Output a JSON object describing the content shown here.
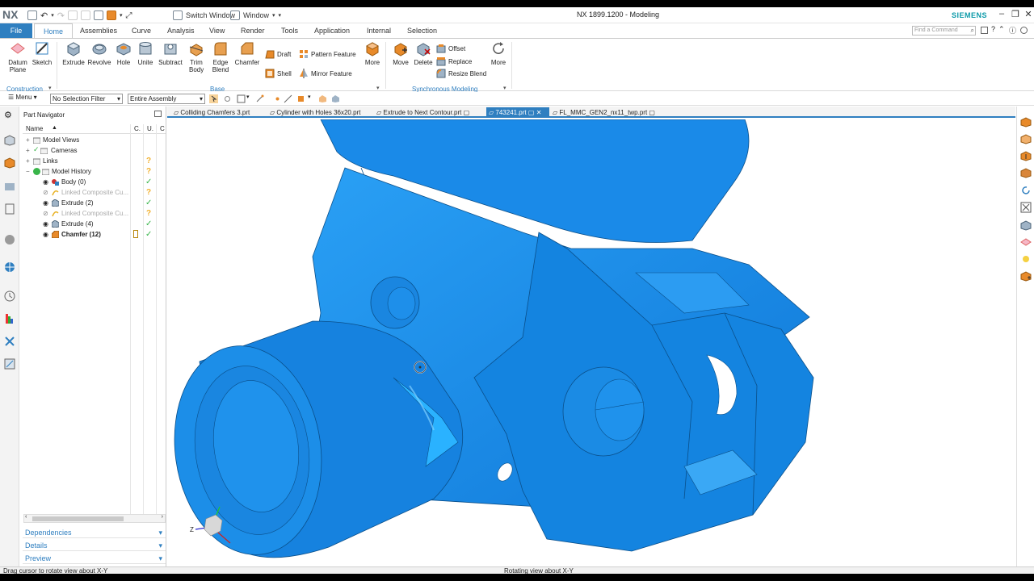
{
  "app": {
    "logo": "NX",
    "title": "NX 1899.1200 - Modeling",
    "brand": "SIEMENS",
    "quick_access": {
      "switch_window": "Switch Window",
      "window": "Window"
    },
    "window_controls": [
      "minimize-icon",
      "restore-icon",
      "close-icon"
    ]
  },
  "menu_tabs": {
    "file": "File",
    "items": [
      "Home",
      "Assemblies",
      "Curve",
      "Analysis",
      "View",
      "Render",
      "Tools",
      "Application",
      "Internal",
      "Selection"
    ],
    "active": "Home",
    "find_command_placeholder": "Find a Command"
  },
  "ribbon": {
    "construction": {
      "label": "Construction",
      "datum_plane": "Datum Plane",
      "sketch": "Sketch"
    },
    "base": {
      "label": "Base",
      "extrude": "Extrude",
      "revolve": "Revolve",
      "hole": "Hole",
      "unite": "Unite",
      "subtract": "Subtract",
      "trim_body": "Trim Body",
      "edge_blend": "Edge Blend",
      "chamfer": "Chamfer",
      "draft": "Draft",
      "shell": "Shell",
      "pattern_feature": "Pattern Feature",
      "mirror_feature": "Mirror Feature",
      "more": "More"
    },
    "synchronous": {
      "label": "Synchronous Modeling",
      "move": "Move",
      "delete": "Delete",
      "offset": "Offset",
      "replace": "Replace",
      "resize_blend": "Resize Blend",
      "more": "More"
    }
  },
  "selection_bar": {
    "menu": "Menu",
    "filter": "No Selection Filter",
    "scope": "Entire Assembly"
  },
  "part_navigator": {
    "title": "Part Navigator",
    "columns": {
      "name": "Name",
      "c": "C.",
      "u": "U.",
      "c2": "C"
    },
    "rows": [
      {
        "label": "Model Views",
        "indent": 0,
        "status": ""
      },
      {
        "label": "Cameras",
        "indent": 0,
        "status": ""
      },
      {
        "label": "Links",
        "indent": 0,
        "status": "?"
      },
      {
        "label": "Model History",
        "indent": 0,
        "status": "?"
      },
      {
        "label": "Body (0)",
        "indent": 1,
        "status": "ok"
      },
      {
        "label": "Linked Composite Cu...",
        "indent": 1,
        "status": "?",
        "grey": true
      },
      {
        "label": "Extrude (2)",
        "indent": 1,
        "status": "ok"
      },
      {
        "label": "Linked Composite Cu...",
        "indent": 1,
        "status": "?",
        "grey": true
      },
      {
        "label": "Extrude (4)",
        "indent": 1,
        "status": "ok"
      },
      {
        "label": "Chamfer (12)",
        "indent": 1,
        "status": "ok",
        "bold": true
      }
    ],
    "panels": [
      "Dependencies",
      "Details",
      "Preview"
    ]
  },
  "doc_tabs": [
    {
      "label": "Colliding Chamfers 3.prt",
      "active": false
    },
    {
      "label": "Cylinder with Holes 36x20.prt",
      "active": false
    },
    {
      "label": "Extrude to Next Contour.prt",
      "active": false
    },
    {
      "label": "743241.prt",
      "active": true
    },
    {
      "label": "FL_MMC_GEN2_nx11_twp.prt",
      "active": false
    }
  ],
  "viewport": {
    "model_color": "#1e90e8",
    "triad_label": "Z"
  },
  "status": {
    "left": "Drag cursor to rotate view about X-Y",
    "center": "Rotating view about X-Y"
  },
  "colors": {
    "accent": "#2f7fc0",
    "ok": "#39b54a",
    "warn": "#f2b233",
    "brand": "#0a99a8"
  }
}
